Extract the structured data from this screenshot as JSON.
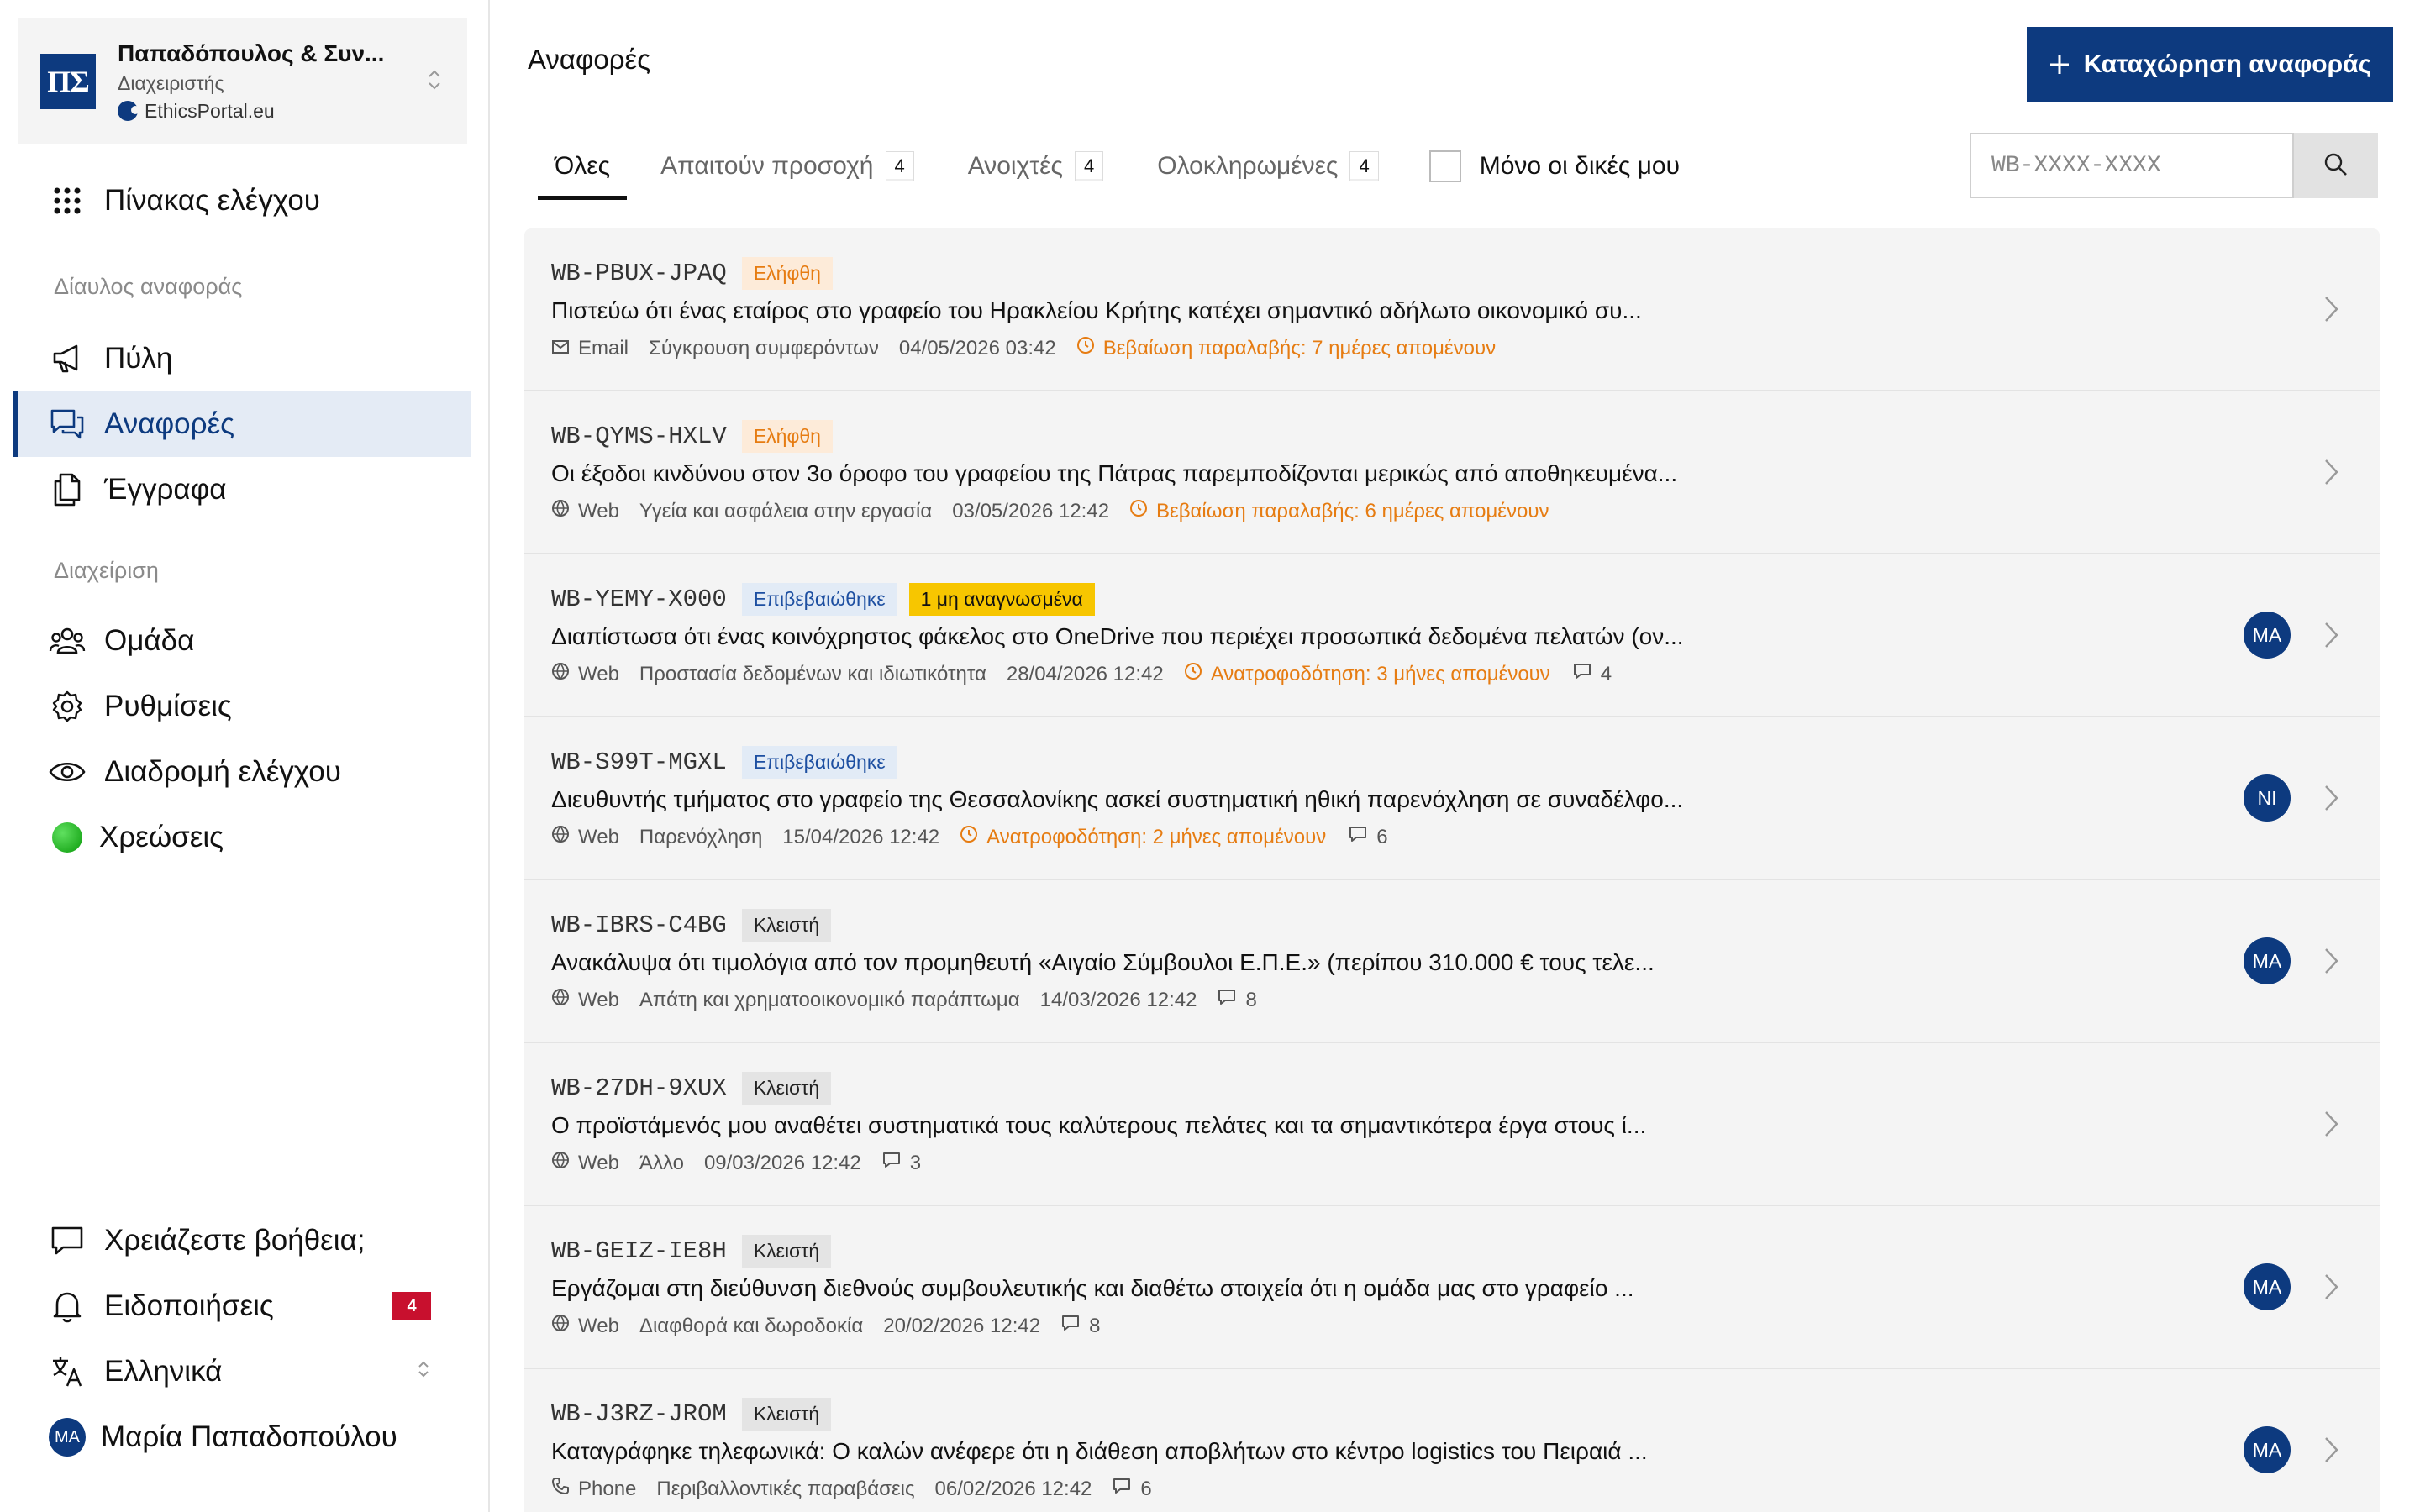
{
  "org": {
    "logo": "ΠΣ",
    "name": "Παπαδόπουλος & Συν...",
    "role": "Διαχειριστής",
    "portal": "EthicsPortal.eu"
  },
  "sidebar": {
    "dashboard": "Πίνακας ελέγχου",
    "section_channel": "Δίαυλος αναφοράς",
    "portal": "Πύλη",
    "reports": "Αναφορές",
    "documents": "Έγγραφα",
    "section_admin": "Διαχείριση",
    "team": "Ομάδα",
    "settings": "Ρυθμίσεις",
    "audit": "Διαδρομή ελέγχου",
    "billing": "Χρεώσεις",
    "help": "Χρειάζεστε βοήθεια;",
    "notifications": "Ειδοποιήσεις",
    "notifications_count": "4",
    "language": "Ελληνικά",
    "user_initials": "MA",
    "user_name": "Μαρία Παπαδοπούλου"
  },
  "header": {
    "title": "Αναφορές",
    "new_report_label": "Καταχώρηση αναφοράς"
  },
  "tabs": [
    {
      "label": "Όλες",
      "count": ""
    },
    {
      "label": "Απαιτούν προσοχή",
      "count": "4"
    },
    {
      "label": "Ανοιχτές",
      "count": "4"
    },
    {
      "label": "Ολοκληρωμένες",
      "count": "4"
    }
  ],
  "filter": {
    "only_mine": "Μόνο οι δικές μου",
    "search_placeholder": "WB-XXXX-XXXX"
  },
  "reports": [
    {
      "id": "WB-PBUX-JPAQ",
      "status": "Ελήφθη",
      "unread": "",
      "text": "Πιστεύω ότι ένας εταίρος στο γραφείο του Ηρακλείου Κρήτης κατέχει σημαντικό αδήλωτο οικονομικό συ...",
      "channel": "Email",
      "category": "Σύγκρουση συμφερόντων",
      "date": "04/05/2026 03:42",
      "deadline": "Βεβαίωση παραλαβής: 7 ημέρες απομένουν",
      "comments": "",
      "assignee": ""
    },
    {
      "id": "WB-QYMS-HXLV",
      "status": "Ελήφθη",
      "unread": "",
      "text": "Οι έξοδοι κινδύνου στον 3ο όροφο του γραφείου της Πάτρας παρεμποδίζονται μερικώς από αποθηκευμένα...",
      "channel": "Web",
      "category": "Υγεία και ασφάλεια στην εργασία",
      "date": "03/05/2026 12:42",
      "deadline": "Βεβαίωση παραλαβής: 6 ημέρες απομένουν",
      "comments": "",
      "assignee": ""
    },
    {
      "id": "WB-YEMY-X000",
      "status": "Επιβεβαιώθηκε",
      "unread": "1 μη αναγνωσμένα",
      "text": "Διαπίστωσα ότι ένας κοινόχρηστος φάκελος στο OneDrive που περιέχει προσωπικά δεδομένα πελατών (ον...",
      "channel": "Web",
      "category": "Προστασία δεδομένων και ιδιωτικότητα",
      "date": "28/04/2026 12:42",
      "deadline": "Ανατροφοδότηση: 3 μήνες απομένουν",
      "comments": "4",
      "assignee": "MA"
    },
    {
      "id": "WB-S99T-MGXL",
      "status": "Επιβεβαιώθηκε",
      "unread": "",
      "text": "Διευθυντής τμήματος στο γραφείο της Θεσσαλονίκης ασκεί συστηματική ηθική παρενόχληση σε συναδέλφο...",
      "channel": "Web",
      "category": "Παρενόχληση",
      "date": "15/04/2026 12:42",
      "deadline": "Ανατροφοδότηση: 2 μήνες απομένουν",
      "comments": "6",
      "assignee": "NI"
    },
    {
      "id": "WB-IBRS-C4BG",
      "status": "Κλειστή",
      "unread": "",
      "text": "Ανακάλυψα ότι τιμολόγια από τον προμηθευτή «Αιγαίο Σύμβουλοι Ε.Π.Ε.» (περίπου 310.000 € τους τελε...",
      "channel": "Web",
      "category": "Απάτη και χρηματοοικονομικό παράπτωμα",
      "date": "14/03/2026 12:42",
      "deadline": "",
      "comments": "8",
      "assignee": "MA"
    },
    {
      "id": "WB-27DH-9XUX",
      "status": "Κλειστή",
      "unread": "",
      "text": "Ο προϊστάμενός μου αναθέτει συστηματικά τους καλύτερους πελάτες και τα σημαντικότερα έργα στους ί...",
      "channel": "Web",
      "category": "Άλλο",
      "date": "09/03/2026 12:42",
      "deadline": "",
      "comments": "3",
      "assignee": ""
    },
    {
      "id": "WB-GEIZ-IE8H",
      "status": "Κλειστή",
      "unread": "",
      "text": "Εργάζομαι στη διεύθυνση διεθνούς συμβουλευτικής και διαθέτω στοιχεία ότι η ομάδα μας στο γραφείο ...",
      "channel": "Web",
      "category": "Διαφθορά και δωροδοκία",
      "date": "20/02/2026 12:42",
      "deadline": "",
      "comments": "8",
      "assignee": "MA"
    },
    {
      "id": "WB-J3RZ-JROM",
      "status": "Κλειστή",
      "unread": "",
      "text": "Καταγράφηκε τηλεφωνικά: Ο καλών ανέφερε ότι η διάθεση αποβλήτων στο κέντρο logistics του Πειραιά ...",
      "channel": "Phone",
      "category": "Περιβαλλοντικές παραβάσεις",
      "date": "06/02/2026 12:42",
      "deadline": "",
      "comments": "6",
      "assignee": "MA"
    }
  ],
  "colors": {
    "brand": "#0d3a7f",
    "received": "#e67c12",
    "unread": "#f7c600",
    "notification": "#c8102e"
  }
}
